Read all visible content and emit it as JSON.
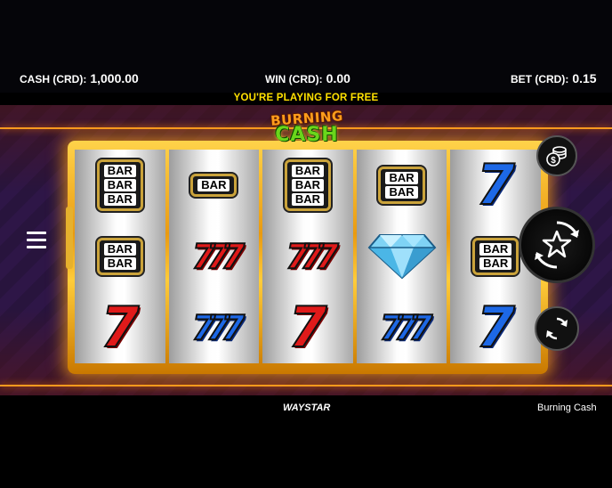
{
  "header": {
    "cash_label": "CASH (CRD):",
    "cash_value": "1,000.00",
    "win_label": "WIN (CRD):",
    "win_value": "0.00",
    "bet_label": "BET (CRD):",
    "bet_value": "0.15",
    "free_play_notice": "YOU'RE PLAYING FOR FREE"
  },
  "logo": {
    "line1": "BURNING",
    "line2": "CASH"
  },
  "reels": [
    [
      {
        "symbol": "bar3",
        "text": [
          "BAR",
          "BAR",
          "BAR"
        ]
      },
      {
        "symbol": "bar2",
        "text": [
          "BAR",
          "BAR"
        ]
      },
      {
        "symbol": "red7",
        "text": "7"
      }
    ],
    [
      {
        "symbol": "bar1",
        "text": [
          "BAR"
        ]
      },
      {
        "symbol": "red777",
        "text": "777"
      },
      {
        "symbol": "blue777",
        "text": "777"
      }
    ],
    [
      {
        "symbol": "bar3",
        "text": [
          "BAR",
          "BAR",
          "BAR"
        ]
      },
      {
        "symbol": "red777",
        "text": "777"
      },
      {
        "symbol": "red7",
        "text": "7"
      }
    ],
    [
      {
        "symbol": "bar2",
        "text": [
          "BAR",
          "BAR"
        ]
      },
      {
        "symbol": "diamond",
        "text": ""
      },
      {
        "symbol": "blue777",
        "text": "777"
      }
    ],
    [
      {
        "symbol": "blue7",
        "text": "7"
      },
      {
        "symbol": "bar2",
        "text": [
          "BAR",
          "BAR"
        ]
      },
      {
        "symbol": "blue7",
        "text": "7"
      }
    ]
  ],
  "controls": {
    "menu_icon": "hamburger-menu-icon",
    "coins_icon": "coin-stack-icon",
    "spin_icon": "star-spin-icon",
    "autoplay_icon": "autoplay-arrows-icon"
  },
  "footer": {
    "brand": "WAYSTAR",
    "game_name": "Burning Cash"
  },
  "colors": {
    "accent_yellow": "#ffe100",
    "frame_gold": "#f0a820",
    "bg_purple": "#2e1845"
  }
}
